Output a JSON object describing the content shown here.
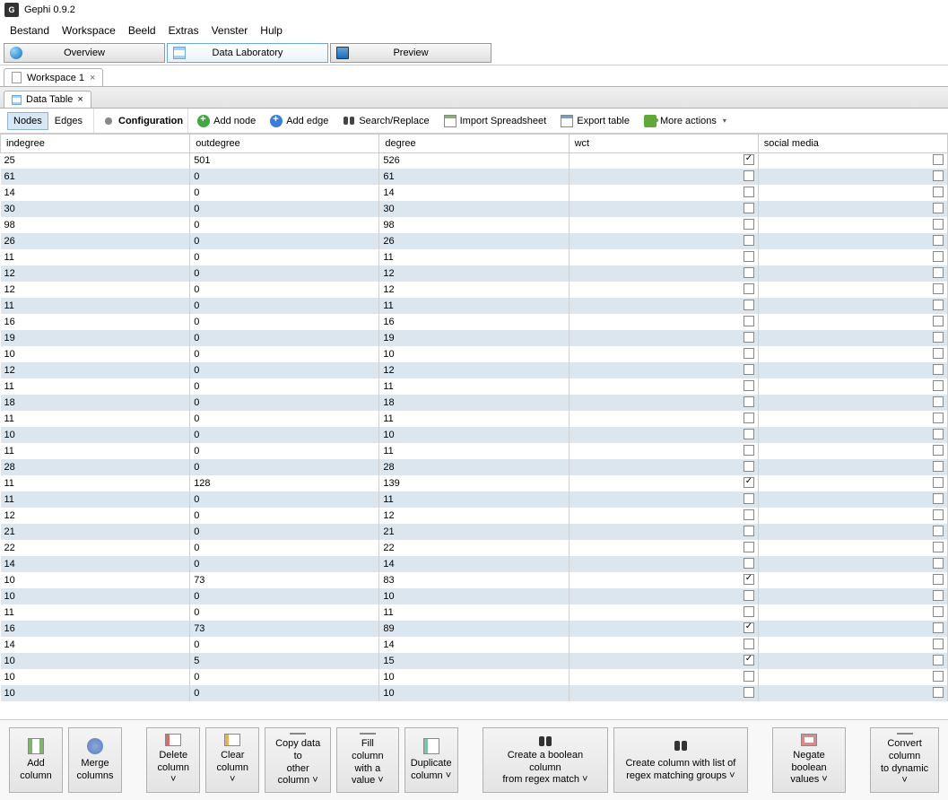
{
  "title": "Gephi 0.9.2",
  "menu": [
    "Bestand",
    "Workspace",
    "Beeld",
    "Extras",
    "Venster",
    "Hulp"
  ],
  "modes": {
    "overview": "Overview",
    "datalab": "Data Laboratory",
    "preview": "Preview"
  },
  "workspaceTab": "Workspace 1",
  "panelTab": "Data Table",
  "toolbar": {
    "nodes": "Nodes",
    "edges": "Edges",
    "config": "Configuration",
    "addNode": "Add node",
    "addEdge": "Add edge",
    "search": "Search/Replace",
    "import": "Import Spreadsheet",
    "export": "Export table",
    "more": "More actions"
  },
  "columns": [
    "indegree",
    "outdegree",
    "degree",
    "wct",
    "social media"
  ],
  "rows": [
    {
      "indegree": "25",
      "outdegree": "501",
      "degree": "526",
      "wct": true,
      "social": false
    },
    {
      "indegree": "61",
      "outdegree": "0",
      "degree": "61",
      "wct": false,
      "social": false
    },
    {
      "indegree": "14",
      "outdegree": "0",
      "degree": "14",
      "wct": false,
      "social": false
    },
    {
      "indegree": "30",
      "outdegree": "0",
      "degree": "30",
      "wct": false,
      "social": false
    },
    {
      "indegree": "98",
      "outdegree": "0",
      "degree": "98",
      "wct": false,
      "social": false
    },
    {
      "indegree": "26",
      "outdegree": "0",
      "degree": "26",
      "wct": false,
      "social": false
    },
    {
      "indegree": "11",
      "outdegree": "0",
      "degree": "11",
      "wct": false,
      "social": false
    },
    {
      "indegree": "12",
      "outdegree": "0",
      "degree": "12",
      "wct": false,
      "social": false
    },
    {
      "indegree": "12",
      "outdegree": "0",
      "degree": "12",
      "wct": false,
      "social": false
    },
    {
      "indegree": "11",
      "outdegree": "0",
      "degree": "11",
      "wct": false,
      "social": false
    },
    {
      "indegree": "16",
      "outdegree": "0",
      "degree": "16",
      "wct": false,
      "social": false
    },
    {
      "indegree": "19",
      "outdegree": "0",
      "degree": "19",
      "wct": false,
      "social": false
    },
    {
      "indegree": "10",
      "outdegree": "0",
      "degree": "10",
      "wct": false,
      "social": false
    },
    {
      "indegree": "12",
      "outdegree": "0",
      "degree": "12",
      "wct": false,
      "social": false
    },
    {
      "indegree": "11",
      "outdegree": "0",
      "degree": "11",
      "wct": false,
      "social": false
    },
    {
      "indegree": "18",
      "outdegree": "0",
      "degree": "18",
      "wct": false,
      "social": false
    },
    {
      "indegree": "11",
      "outdegree": "0",
      "degree": "11",
      "wct": false,
      "social": false
    },
    {
      "indegree": "10",
      "outdegree": "0",
      "degree": "10",
      "wct": false,
      "social": false
    },
    {
      "indegree": "11",
      "outdegree": "0",
      "degree": "11",
      "wct": false,
      "social": false
    },
    {
      "indegree": "28",
      "outdegree": "0",
      "degree": "28",
      "wct": false,
      "social": false
    },
    {
      "indegree": "11",
      "outdegree": "128",
      "degree": "139",
      "wct": true,
      "social": false
    },
    {
      "indegree": "11",
      "outdegree": "0",
      "degree": "11",
      "wct": false,
      "social": false
    },
    {
      "indegree": "12",
      "outdegree": "0",
      "degree": "12",
      "wct": false,
      "social": false
    },
    {
      "indegree": "21",
      "outdegree": "0",
      "degree": "21",
      "wct": false,
      "social": false
    },
    {
      "indegree": "22",
      "outdegree": "0",
      "degree": "22",
      "wct": false,
      "social": false
    },
    {
      "indegree": "14",
      "outdegree": "0",
      "degree": "14",
      "wct": false,
      "social": false
    },
    {
      "indegree": "10",
      "outdegree": "73",
      "degree": "83",
      "wct": true,
      "social": false
    },
    {
      "indegree": "10",
      "outdegree": "0",
      "degree": "10",
      "wct": false,
      "social": false
    },
    {
      "indegree": "11",
      "outdegree": "0",
      "degree": "11",
      "wct": false,
      "social": false
    },
    {
      "indegree": "16",
      "outdegree": "73",
      "degree": "89",
      "wct": true,
      "social": false
    },
    {
      "indegree": "14",
      "outdegree": "0",
      "degree": "14",
      "wct": false,
      "social": false
    },
    {
      "indegree": "10",
      "outdegree": "5",
      "degree": "15",
      "wct": true,
      "social": false
    },
    {
      "indegree": "10",
      "outdegree": "0",
      "degree": "10",
      "wct": false,
      "social": false
    },
    {
      "indegree": "10",
      "outdegree": "0",
      "degree": "10",
      "wct": false,
      "social": false
    }
  ],
  "bottom": {
    "add": "Add\ncolumn",
    "merge": "Merge\ncolumns",
    "del": "Delete\ncolumn ˅",
    "clr": "Clear\ncolumn ˅",
    "copy": "Copy data to\nother column ˅",
    "fill": "Fill column\nwith a value ˅",
    "dup": "Duplicate\ncolumn ˅",
    "bool1": "Create a boolean column\nfrom regex match ˅",
    "bool2": "Create column with list of\nregex matching groups ˅",
    "neg": "Negate\nboolean values ˅",
    "dyn": "Convert column\nto dynamic ˅"
  }
}
